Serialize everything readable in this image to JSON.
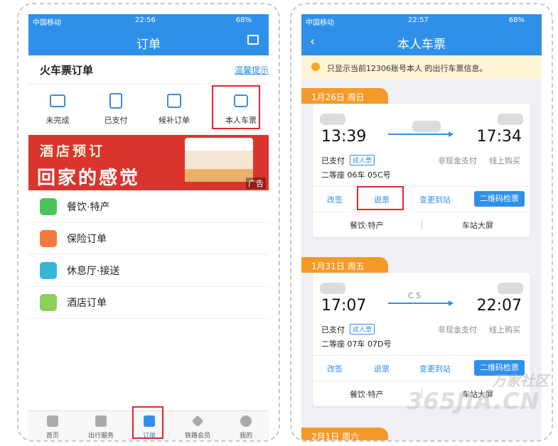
{
  "left": {
    "status": {
      "carrier": "中国移动",
      "time": "22:56",
      "battery": "68%"
    },
    "nav_title": "订单",
    "section_title": "火车票订单",
    "tip_link": "温馨提示",
    "tabs": [
      {
        "label": "未完成",
        "icon": "card-icon"
      },
      {
        "label": "已支付",
        "icon": "document-icon"
      },
      {
        "label": "候补订单",
        "icon": "calendar-icon"
      },
      {
        "label": "本人车票",
        "icon": "suitcase-icon"
      }
    ],
    "banner": {
      "line1": "酒店预订",
      "line2": "回家的感觉",
      "ad": "广告"
    },
    "menu": [
      {
        "label": "餐饮·特产",
        "color": "#4cc35a"
      },
      {
        "label": "保险订单",
        "color": "#f07b3c"
      },
      {
        "label": "休息厅·接送",
        "color": "#35b7d6"
      },
      {
        "label": "酒店订单",
        "color": "#8ad15a"
      }
    ],
    "bottom_nav": [
      {
        "label": "首页"
      },
      {
        "label": "出行服务"
      },
      {
        "label": "订单"
      },
      {
        "label": "铁路会员"
      },
      {
        "label": "我的"
      }
    ]
  },
  "right": {
    "status": {
      "carrier": "中国移动",
      "time": "22:57",
      "battery": "68%"
    },
    "nav_title": "本人车票",
    "notice": "只显示当前12306账号本人  的出行车票信息。",
    "tickets": [
      {
        "date": "1月26日 周日",
        "depart": "13:39",
        "arrive": "17:34",
        "train": "",
        "status": "已支付",
        "badge": "成人票",
        "pay_type": "非现金支付",
        "channel": "线上购买",
        "seat": "二等座 06车 05C号",
        "actions": [
          "改签",
          "退票",
          "变更到站"
        ],
        "qr": "二维码检票",
        "links": [
          "餐饮·特产",
          "车站大屏"
        ]
      },
      {
        "date": "1月31日 周五",
        "depart": "17:07",
        "arrive": "22:07",
        "train": "C  5",
        "status": "已支付",
        "badge": "成人票",
        "pay_type": "非现金支付",
        "channel": "线上购买",
        "seat": "二等座 07车 07D号",
        "actions": [
          "改签",
          "退票",
          "变更到站"
        ],
        "qr": "二维码检票",
        "links": [
          "餐饮·特产",
          "车站大屏"
        ]
      }
    ],
    "next_date": "2月1日 周六"
  },
  "watermark": {
    "line1": "万家社区",
    "line2": "365JIA.CN"
  },
  "accent": "#2f90ea",
  "highlight": "#e0262b"
}
